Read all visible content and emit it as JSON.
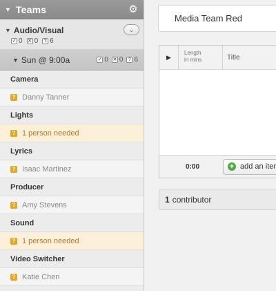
{
  "sidebar": {
    "title": "Teams",
    "section": {
      "name": "Audio/Visual",
      "counts": {
        "confirmed": "0",
        "declined": "0",
        "unconfirmed": "6"
      }
    },
    "time": {
      "label": "Sun @ 9:00a",
      "counts": {
        "confirmed": "0",
        "declined": "0",
        "unconfirmed": "6"
      }
    },
    "positions": [
      {
        "name": "Camera",
        "person": "Danny Tanner",
        "needed": false
      },
      {
        "name": "Lights",
        "person": "1 person needed",
        "needed": true
      },
      {
        "name": "Lyrics",
        "person": "Isaac Martinez",
        "needed": false
      },
      {
        "name": "Producer",
        "person": "Amy Stevens",
        "needed": false
      },
      {
        "name": "Sound",
        "person": "1 person needed",
        "needed": true
      },
      {
        "name": "Video Switcher",
        "person": "Katie Chen",
        "needed": false
      }
    ],
    "badge_glyph": "?"
  },
  "main": {
    "team_name": "Media Team Red",
    "schedule": {
      "columns": {
        "length": [
          "Length",
          "in mins"
        ],
        "title": "Title"
      },
      "total_time": "0:00",
      "add_item_label": "add an item"
    },
    "contributors": {
      "count": "1",
      "label": "contributor"
    }
  },
  "icons": {
    "teams_toggle": "triangle-down-icon",
    "settings": "gear-icon",
    "section_menu": "chevron-down-icon",
    "play": "play-icon",
    "add": "plus-icon",
    "status_unconfirmed": "question-icon"
  },
  "colors": {
    "header_bg": "#8f8f8f",
    "needed_bg": "#fdf0d8",
    "needed_text": "#b07a2a",
    "badge": "#e0a826",
    "add_green": "#55a545"
  }
}
